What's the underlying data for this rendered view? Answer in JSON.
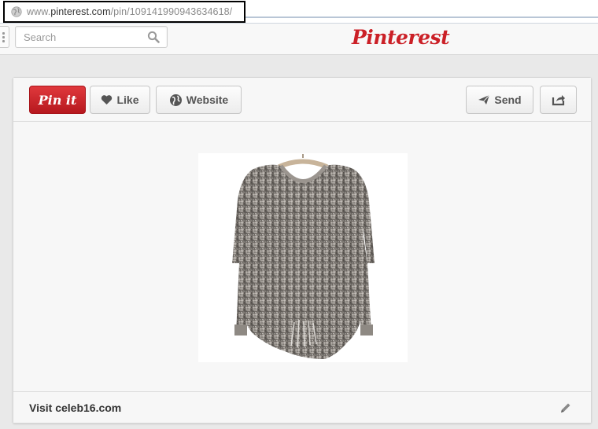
{
  "browser": {
    "url_domain": "www.pinterest.com",
    "url_path": "/pin/109141990943634618/",
    "url_prefix": "www."
  },
  "header": {
    "logo_text": "Pinterest",
    "search_placeholder": "Search",
    "brand_color": "#cb2027"
  },
  "pin": {
    "toolbar": {
      "pin_it_label": "Pin it",
      "like_label": "Like",
      "website_label": "Website",
      "send_label": "Send"
    },
    "image_subject": "gray knit sweater",
    "image_icon": "sweater-image",
    "visit_text": "Visit celeb16.com"
  }
}
